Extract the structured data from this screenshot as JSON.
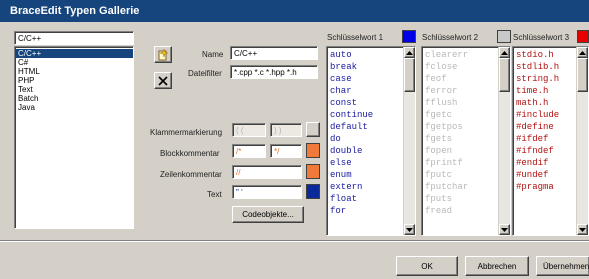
{
  "window": {
    "title": "BraceEdit Typen Gallerie"
  },
  "languages": {
    "current": "C/C++",
    "items": [
      "C/C++",
      "C#",
      "HTML",
      "PHP",
      "Text",
      "Batch",
      "Java"
    ]
  },
  "form": {
    "name_label": "Name",
    "name_value": "C/C++",
    "filter_label": "Dateifilter",
    "filter_value": "*.cpp *.c *.hpp *.h",
    "bracket_label": "Klammermarkierung",
    "bracket_open": "( (",
    "bracket_close": ") )",
    "block_label": "Blockkommentar",
    "block_open": "/*",
    "block_close": "*/",
    "line_label": "Zeilenkommentar",
    "line_value": "//",
    "text_label": "Text",
    "text_value": "\" '",
    "code_objects_button": "Codeobjekte...",
    "block_color": "#f07a3a",
    "line_color": "#f07a3a",
    "text_color": "#0a2a9a"
  },
  "keywords": [
    {
      "header": "Schlüsselwort 1",
      "color": "#0000e8",
      "text_color": "#1a1aa0",
      "items": [
        "auto",
        "break",
        "case",
        "char",
        "const",
        "continue",
        "default",
        "do",
        "double",
        "else",
        "enum",
        "extern",
        "float",
        "for"
      ]
    },
    {
      "header": "Schlüsselwort 2",
      "color": "#c8c8c8",
      "text_color": "#b8b8b8",
      "items": [
        "clearerr",
        "fclose",
        "feof",
        "ferror",
        "fflush",
        "fgetc",
        "fgetpos",
        "fgets",
        "fopen",
        "fprintf",
        "fputc",
        "fputchar",
        "fputs",
        "fread"
      ]
    },
    {
      "header": "Schlüsselwort 3",
      "color": "#e80000",
      "text_color": "#b01010",
      "items": [
        "stdio.h",
        "stdlib.h",
        "string.h",
        "time.h",
        "math.h",
        "#include",
        "#define",
        "#ifdef",
        "#ifndef",
        "#endif",
        "#undef",
        "#pragma"
      ]
    }
  ],
  "buttons": {
    "ok": "OK",
    "cancel": "Abbrechen",
    "apply": "Übernehmen"
  },
  "icons": {
    "new": "new-document-icon",
    "delete": "delete-x-icon"
  }
}
